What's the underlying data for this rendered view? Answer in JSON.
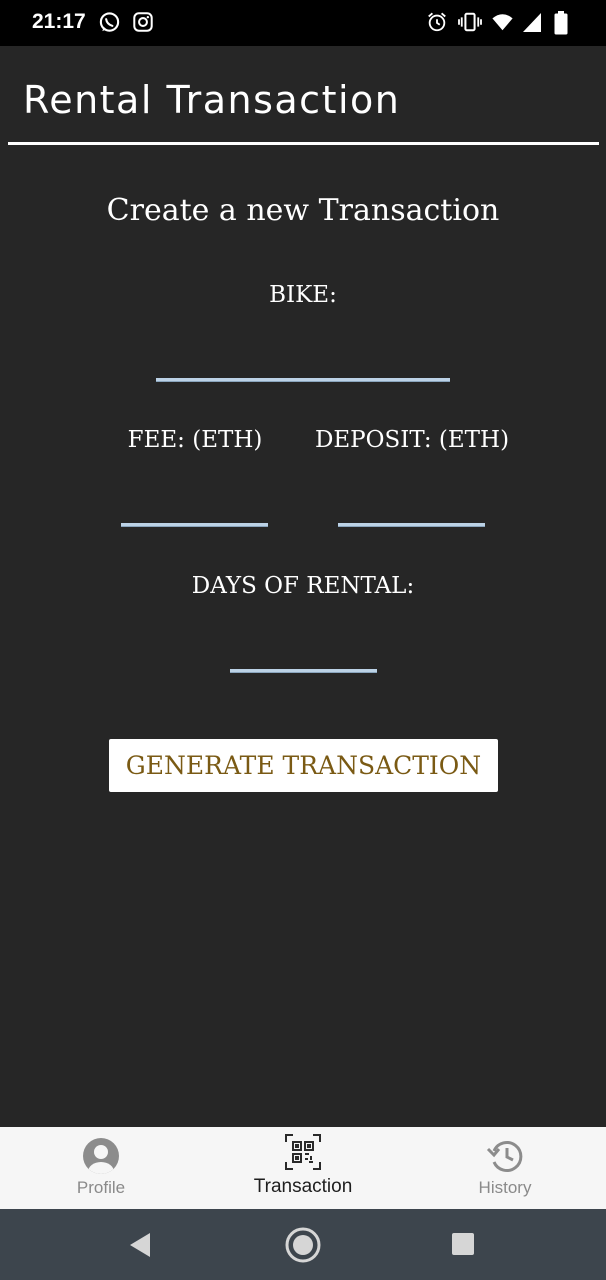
{
  "status_bar": {
    "time": "21:17",
    "left_icons": [
      "whatsapp-icon",
      "instagram-icon"
    ],
    "right_icons": [
      "alarm-icon",
      "vibrate-icon",
      "wifi-icon",
      "signal-icon",
      "battery-icon"
    ]
  },
  "header": {
    "title": "Rental Transaction"
  },
  "form": {
    "heading": "Create a new Transaction",
    "bike_label": "BIKE:",
    "bike_value": "",
    "fee_label": "FEE: (ETH)",
    "fee_value": "",
    "deposit_label": "DEPOSIT: (ETH)",
    "deposit_value": "",
    "days_label": "DAYS OF RENTAL:",
    "days_value": "",
    "generate_label": "GENERATE TRANSACTION"
  },
  "bottom_nav": {
    "items": [
      {
        "label": "Profile",
        "icon": "profile-icon",
        "active": false
      },
      {
        "label": "Transaction",
        "icon": "qr-code-icon",
        "active": true
      },
      {
        "label": "History",
        "icon": "history-icon",
        "active": false
      }
    ]
  },
  "system_nav": [
    "back-icon",
    "home-icon",
    "recents-icon"
  ],
  "colors": {
    "background": "#262626",
    "accent_text": "#7a5a14",
    "field_underline": "#bcd2e6",
    "nav_bar": "#f6f6f6",
    "system_nav": "#3d454d"
  }
}
